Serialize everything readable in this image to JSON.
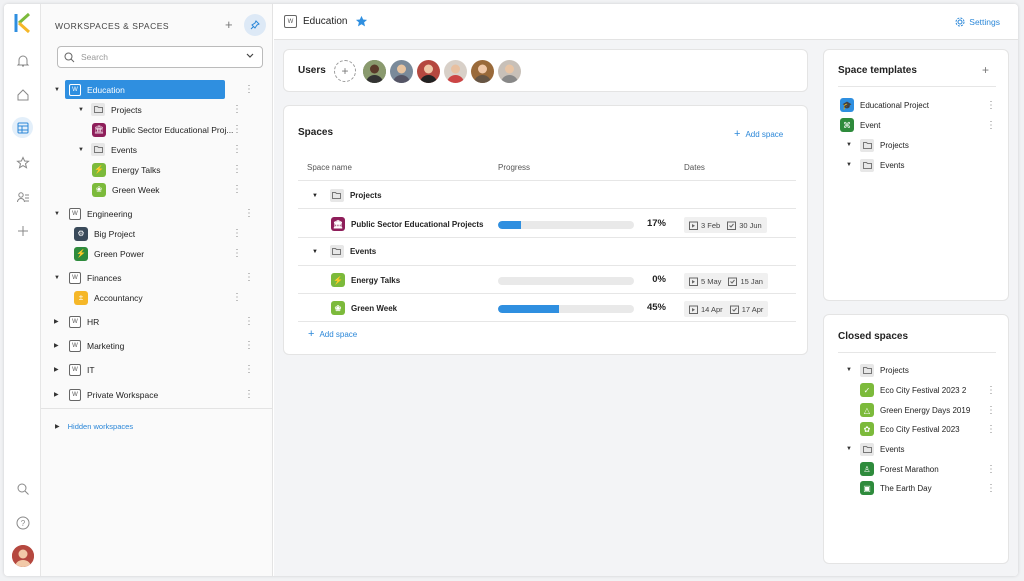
{
  "colors": {
    "accent": "#2f8fe0",
    "purple": "#8e1e5a",
    "green": "#7cba3b",
    "darkgreen": "#2e8b3c",
    "orange": "#f5b728",
    "dark": "#3a4a5a",
    "blue": "#2f8fe0"
  },
  "sidebar": {
    "title": "WORKSPACES & SPACES",
    "search_placeholder": "Search",
    "hidden_workspaces": "Hidden workspaces",
    "items": [
      {
        "label": "Education"
      },
      {
        "label": "Projects"
      },
      {
        "label": "Public Sector Educational Proj..."
      },
      {
        "label": "Events"
      },
      {
        "label": "Energy Talks"
      },
      {
        "label": "Green Week"
      },
      {
        "label": "Engineering"
      },
      {
        "label": "Big Project"
      },
      {
        "label": "Green Power"
      },
      {
        "label": "Finances"
      },
      {
        "label": "Accountancy"
      },
      {
        "label": "HR"
      },
      {
        "label": "Marketing"
      },
      {
        "label": "IT"
      },
      {
        "label": "Private Workspace"
      }
    ]
  },
  "header": {
    "title": "Education",
    "settings": "Settings"
  },
  "users": {
    "title": "Users"
  },
  "spaces": {
    "title": "Spaces",
    "add_space": "Add space",
    "add_space_bottom": "Add space",
    "columns": {
      "name": "Space name",
      "progress": "Progress",
      "dates": "Dates"
    },
    "rows": [
      {
        "name": "Projects",
        "kind": "folder"
      },
      {
        "name": "Public Sector Educational Projects",
        "kind": "space",
        "progress": 17,
        "progress_label": "17%",
        "start": "3 Feb",
        "end": "30 Jun"
      },
      {
        "name": "Events",
        "kind": "folder"
      },
      {
        "name": "Energy Talks",
        "kind": "space",
        "progress": 0,
        "progress_label": "0%",
        "start": "5 May",
        "end": "15 Jan"
      },
      {
        "name": "Green Week",
        "kind": "space",
        "progress": 45,
        "progress_label": "45%",
        "start": "14 Apr",
        "end": "17 Apr"
      }
    ]
  },
  "templates": {
    "title": "Space templates",
    "items": [
      {
        "label": "Educational Project"
      },
      {
        "label": "Event"
      },
      {
        "label": "Projects"
      },
      {
        "label": "Events"
      }
    ]
  },
  "closed": {
    "title": "Closed spaces",
    "items": [
      {
        "label": "Projects"
      },
      {
        "label": "Eco City Festival 2023 2"
      },
      {
        "label": "Green Energy Days 2019"
      },
      {
        "label": "Eco City Festival 2023"
      },
      {
        "label": "Events"
      },
      {
        "label": "Forest Marathon"
      },
      {
        "label": "The Earth Day"
      }
    ]
  }
}
